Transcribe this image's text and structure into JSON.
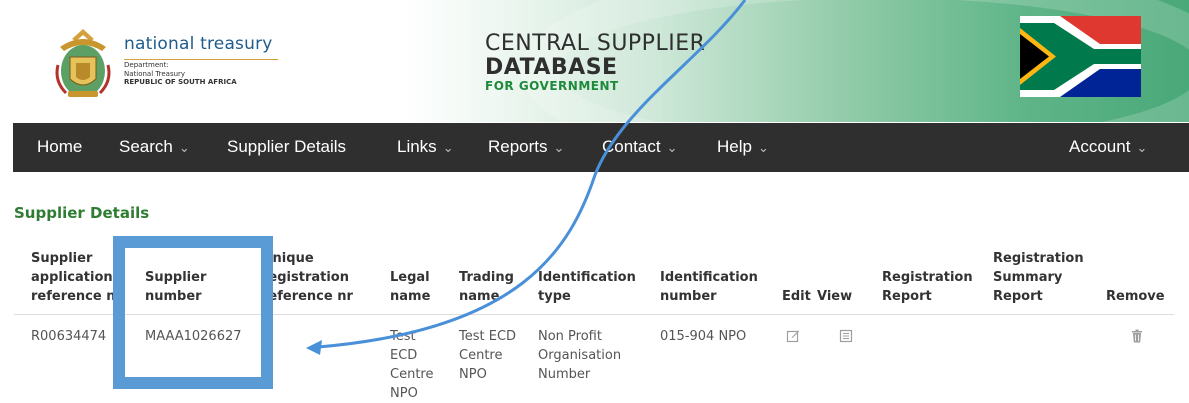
{
  "header": {
    "org_name": "national treasury",
    "dept_line1": "Department:",
    "dept_line2": "National Treasury",
    "dept_line3": "REPUBLIC OF SOUTH AFRICA",
    "title_line1": "CENTRAL SUPPLIER",
    "title_line2": "DATABASE",
    "title_line3": "FOR GOVERNMENT"
  },
  "nav": {
    "items": [
      {
        "label": "Home",
        "dropdown": false
      },
      {
        "label": "Search",
        "dropdown": true
      },
      {
        "label": "Supplier Details",
        "dropdown": false
      },
      {
        "label": "Links",
        "dropdown": true
      },
      {
        "label": "Reports",
        "dropdown": true
      },
      {
        "label": "Contact",
        "dropdown": true
      },
      {
        "label": "Help",
        "dropdown": true
      }
    ],
    "account": {
      "label": "Account",
      "dropdown": true
    },
    "caret": "⌄"
  },
  "page": {
    "title": "Supplier Details"
  },
  "table": {
    "headers": {
      "app_ref": [
        "Supplier",
        "application",
        "reference nr"
      ],
      "supplier_number": [
        "Supplier",
        "number"
      ],
      "unique_reg": [
        "Unique",
        "registration",
        "reference nr"
      ],
      "legal_name": [
        "Legal",
        "name"
      ],
      "trading_name": [
        "Trading",
        "name"
      ],
      "id_type": [
        "Identification",
        "type"
      ],
      "id_number": [
        "Identification",
        "number"
      ],
      "edit": "Edit",
      "view": "View",
      "reg_report": [
        "Registration",
        "Report"
      ],
      "reg_summary": [
        "Registration",
        "Summary",
        "Report"
      ],
      "remove": "Remove"
    },
    "rows": [
      {
        "app_ref": "R00634474",
        "supplier_number": "MAAA1026627",
        "unique_reg": "",
        "legal_name": [
          "Test",
          "ECD",
          "Centre",
          "NPO"
        ],
        "trading_name": [
          "Test ECD",
          "Centre",
          "NPO"
        ],
        "id_type": [
          "Non Profit",
          "Organisation",
          "Number"
        ],
        "id_number": "015-904 NPO"
      }
    ]
  },
  "icons": {
    "edit": "edit-icon",
    "view": "list-icon",
    "remove": "trash-icon"
  },
  "colors": {
    "nav_bg": "#2f2f2f",
    "title_green": "#2e7d32",
    "highlight_blue": "#5b9bd5",
    "treasury_blue": "#1f5c8a"
  }
}
